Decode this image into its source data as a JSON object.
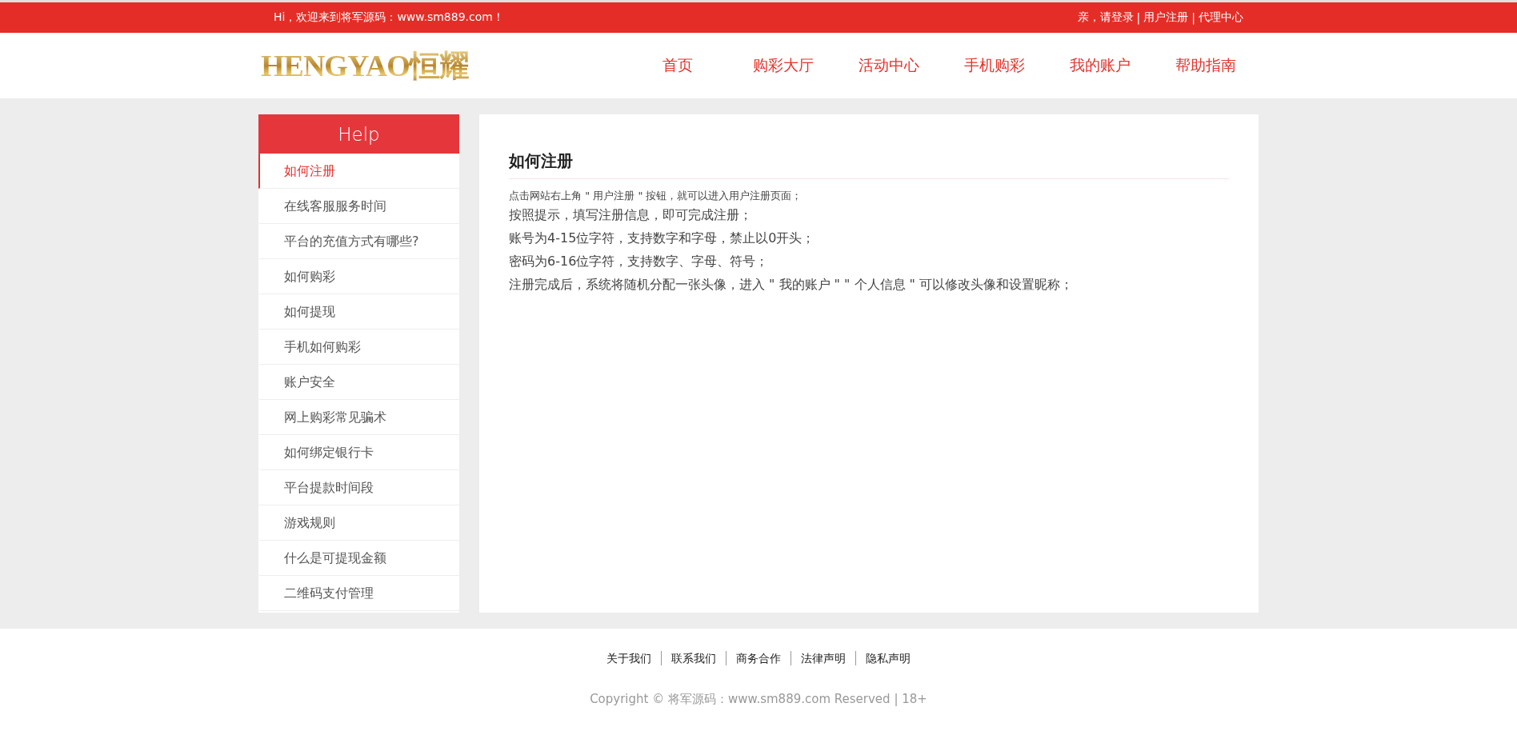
{
  "top_bar": {
    "greeting": "Hi，欢迎来到将军源码：www.sm889.com！",
    "separator": "|",
    "links": [
      "亲，请登录",
      "用户注册",
      "代理中心"
    ]
  },
  "header": {
    "logo": "HENGYAO恒耀",
    "nav": [
      "首页",
      "购彩大厅",
      "活动中心",
      "手机购彩",
      "我的账户",
      "帮助指南"
    ]
  },
  "sidebar": {
    "title": "Help",
    "items": [
      {
        "label": "如何注册",
        "selected": true
      },
      {
        "label": "在线客服服务时间",
        "selected": false
      },
      {
        "label": "平台的充值方式有哪些?",
        "selected": false
      },
      {
        "label": "如何购彩",
        "selected": false
      },
      {
        "label": "如何提现",
        "selected": false
      },
      {
        "label": "手机如何购彩",
        "selected": false
      },
      {
        "label": "账户安全",
        "selected": false
      },
      {
        "label": "网上购彩常见骗术",
        "selected": false
      },
      {
        "label": "如何绑定银行卡",
        "selected": false
      },
      {
        "label": "平台提款时间段",
        "selected": false
      },
      {
        "label": "游戏规则",
        "selected": false
      },
      {
        "label": "什么是可提现金额",
        "selected": false
      },
      {
        "label": "二维码支付管理",
        "selected": false
      }
    ]
  },
  "article": {
    "title": "如何注册",
    "intro": "点击网站右上角 \" 用户注册 \" 按钮，就可以进入用户注册页面；",
    "lines": [
      "按照提示，填写注册信息，即可完成注册；",
      "账号为4-15位字符，支持数字和字母，禁止以0开头；",
      "密码为6-16位字符，支持数字、字母、符号；",
      "注册完成后，系统将随机分配一张头像，进入 \" 我的账户 \"  \" 个人信息 \" 可以修改头像和设置昵称；"
    ]
  },
  "footer": {
    "links": [
      "关于我们",
      "联系我们",
      "商务合作",
      "法律声明",
      "隐私声明"
    ],
    "copyright": "Copyright © 将军源码：www.sm889.com Reserved | 18+"
  }
}
